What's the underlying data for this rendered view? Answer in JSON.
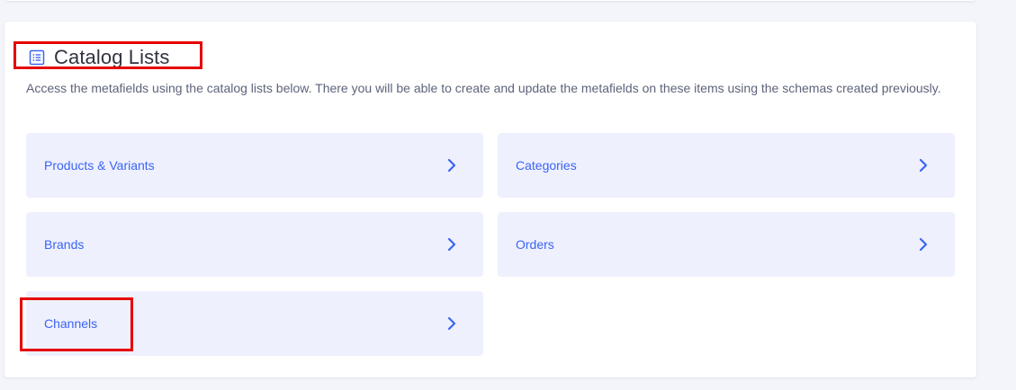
{
  "section": {
    "title": "Catalog Lists",
    "description": "Access the metafields using the catalog lists below. There you will be able to create and update the metafields on these items using the schemas created previously.",
    "icon": "list-icon"
  },
  "tiles": [
    {
      "label": "Products & Variants",
      "icon": "chevron-right-icon"
    },
    {
      "label": "Categories",
      "icon": "chevron-right-icon"
    },
    {
      "label": "Brands",
      "icon": "chevron-right-icon"
    },
    {
      "label": "Orders",
      "icon": "chevron-right-icon"
    },
    {
      "label": "Channels",
      "icon": "chevron-right-icon"
    }
  ],
  "colors": {
    "page_background": "#f4f5fa",
    "card_background": "#ffffff",
    "tile_background": "#eef0fd",
    "accent": "#3c64f4",
    "title_text": "#313440",
    "body_text": "#5e637a",
    "highlight": "#e60000"
  }
}
